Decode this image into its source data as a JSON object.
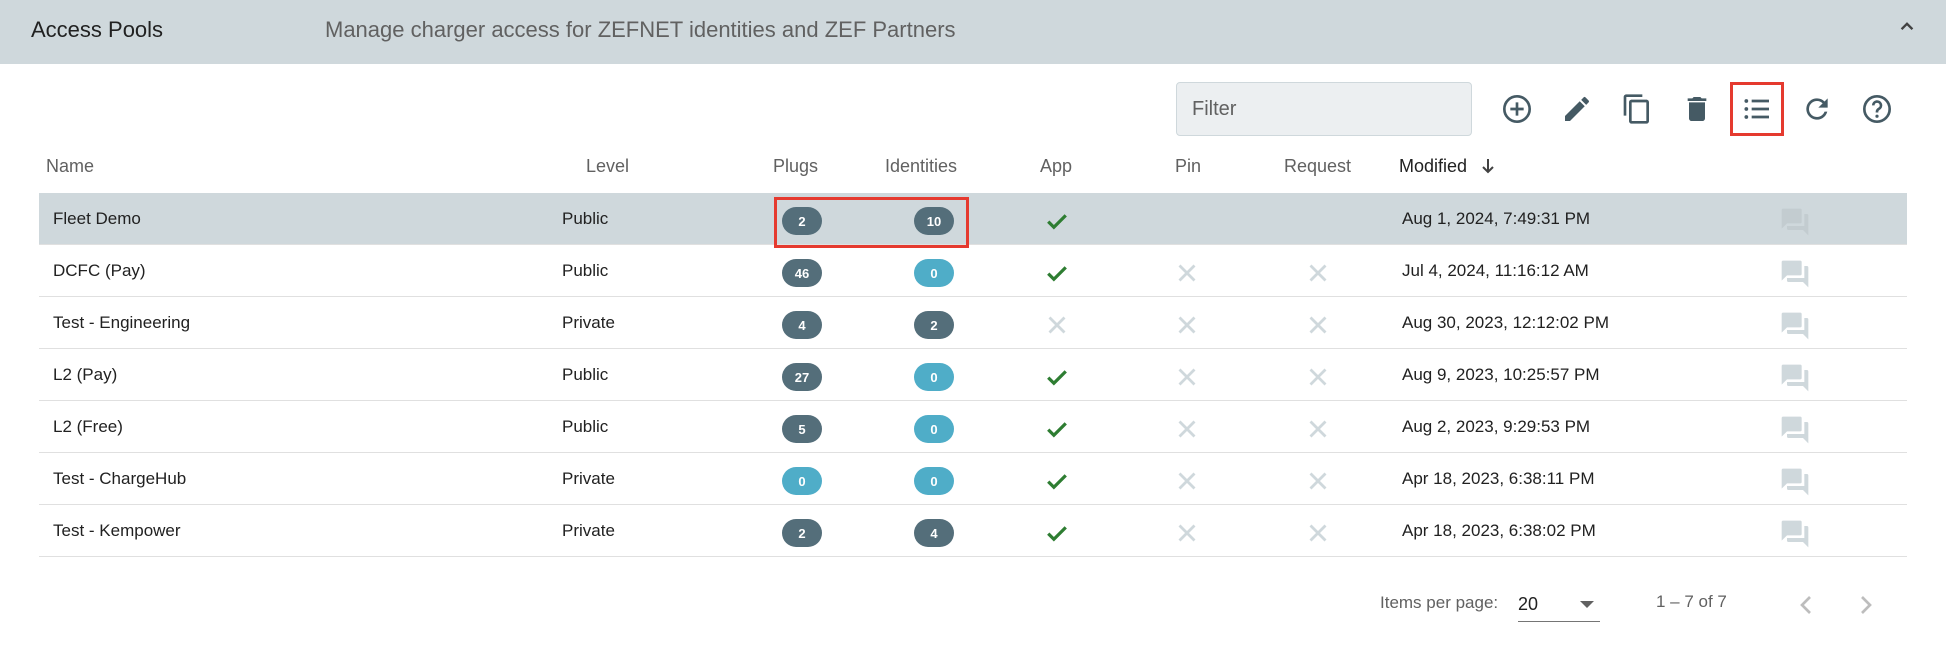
{
  "header": {
    "title": "Access Pools",
    "subtitle": "Manage charger access for ZEFNET identities and ZEF Partners"
  },
  "toolbar": {
    "filter_placeholder": "Filter",
    "buttons": [
      {
        "name": "add-icon",
        "semantic": "add"
      },
      {
        "name": "edit-icon",
        "semantic": "edit"
      },
      {
        "name": "copy-icon",
        "semantic": "copy"
      },
      {
        "name": "delete-icon",
        "semantic": "delete"
      },
      {
        "name": "list-icon",
        "semantic": "list",
        "highlighted": true
      },
      {
        "name": "refresh-icon",
        "semantic": "refresh"
      },
      {
        "name": "help-icon",
        "semantic": "help"
      }
    ]
  },
  "table": {
    "columns": [
      "Name",
      "Level",
      "Plugs",
      "Identities",
      "App",
      "Pin",
      "Request",
      "Modified"
    ],
    "sort": {
      "column": "Modified",
      "direction": "desc"
    },
    "rows": [
      {
        "name": "Fleet Demo",
        "level": "Public",
        "plugs": "2",
        "identities": "10",
        "app": true,
        "pin": false,
        "request": false,
        "modified": "Aug 1, 2024, 7:49:31 PM",
        "selected": true
      },
      {
        "name": "DCFC (Pay)",
        "level": "Public",
        "plugs": "46",
        "identities": "0",
        "app": true,
        "pin": false,
        "request": false,
        "modified": "Jul 4, 2024, 11:16:12 AM"
      },
      {
        "name": "Test - Engineering",
        "level": "Private",
        "plugs": "4",
        "identities": "2",
        "app": false,
        "pin": false,
        "request": false,
        "modified": "Aug 30, 2023, 12:12:02 PM"
      },
      {
        "name": "L2 (Pay)",
        "level": "Public",
        "plugs": "27",
        "identities": "0",
        "app": true,
        "pin": false,
        "request": false,
        "modified": "Aug 9, 2023, 10:25:57 PM"
      },
      {
        "name": "L2 (Free)",
        "level": "Public",
        "plugs": "5",
        "identities": "0",
        "app": true,
        "pin": false,
        "request": false,
        "modified": "Aug 2, 2023, 9:29:53 PM"
      },
      {
        "name": "Test - ChargeHub",
        "level": "Private",
        "plugs": "0",
        "identities": "0",
        "app": true,
        "pin": false,
        "request": false,
        "modified": "Apr 18, 2023, 6:38:11 PM"
      },
      {
        "name": "Test - Kempower",
        "level": "Private",
        "plugs": "2",
        "identities": "4",
        "app": true,
        "pin": false,
        "request": false,
        "modified": "Apr 18, 2023, 6:38:02 PM"
      }
    ]
  },
  "paginator": {
    "items_per_page_label": "Items per page:",
    "items_per_page": "20",
    "range": "1 – 7 of 7"
  },
  "colors": {
    "header_bg": "#cfd8dc",
    "badge_dark": "#546e7a",
    "badge_zero": "#4fadc8",
    "check": "#2e7d32",
    "cross": "#cfd8dc",
    "highlight": "#e53a2f"
  }
}
